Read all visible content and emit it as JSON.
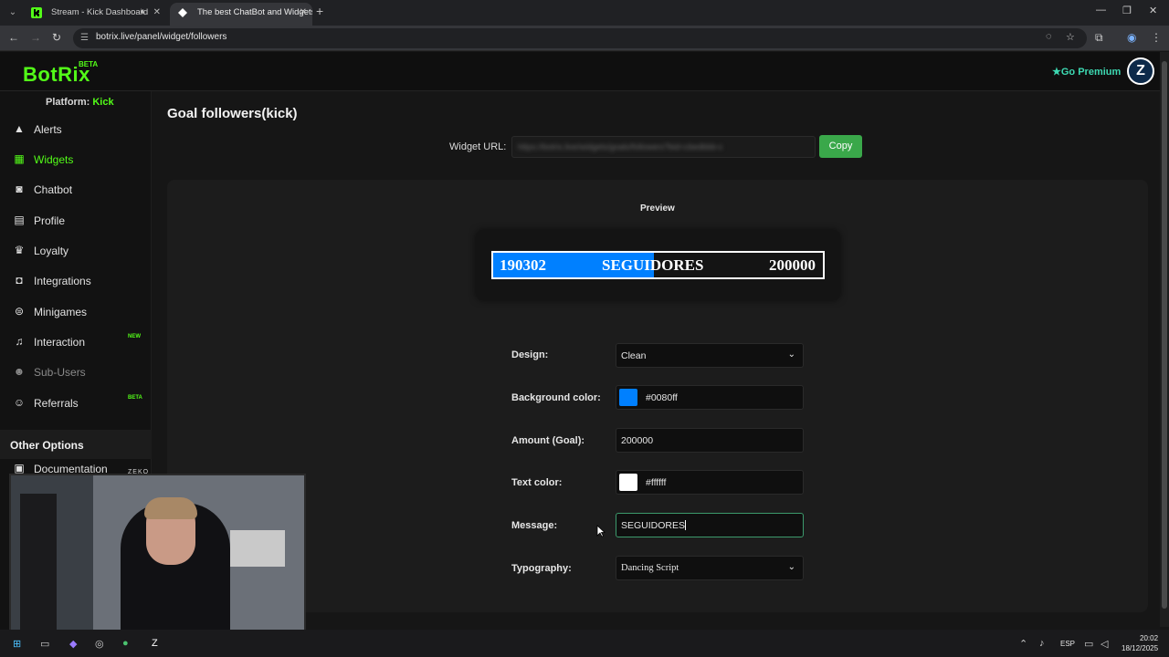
{
  "browser": {
    "tabs": [
      {
        "title": "Stream - Kick Dashboard",
        "active": false
      },
      {
        "title": "The best ChatBot and Widgets",
        "active": true
      }
    ],
    "url": "botrix.live/panel/widget/followers"
  },
  "header": {
    "logo": "BotRix",
    "logo_badge": "BETA",
    "premium_label": "Go Premium",
    "accent_color": "#53fc18"
  },
  "sidebar": {
    "platform_label": "Platform:",
    "platform_value": "Kick",
    "items": [
      {
        "label": "Alerts",
        "icon": "warning-icon"
      },
      {
        "label": "Widgets",
        "icon": "grid-icon",
        "active": true
      },
      {
        "label": "Chatbot",
        "icon": "robot-icon"
      },
      {
        "label": "Profile",
        "icon": "id-card-icon"
      },
      {
        "label": "Loyalty",
        "icon": "trophy-icon"
      },
      {
        "label": "Integrations",
        "icon": "puzzle-icon"
      },
      {
        "label": "Minigames",
        "icon": "gamepad-icon"
      },
      {
        "label": "Interaction",
        "icon": "music-icon",
        "badge": "NEW"
      },
      {
        "label": "Sub-Users",
        "icon": "users-icon",
        "disabled": true
      },
      {
        "label": "Referrals",
        "icon": "referral-icon",
        "badge": "BETA"
      }
    ],
    "other_options": "Other Options",
    "documentation": "Documentation"
  },
  "main": {
    "title": "Goal followers(kick)",
    "widget_url_label": "Widget URL:",
    "widget_url_value": "https://botrix.live/widgets/goals/followers?bid=cbedbbb-c",
    "copy_label": "Copy",
    "preview_label": "Preview",
    "goal": {
      "current": "190302",
      "message": "SEGUIDORES",
      "target": "200000",
      "progress": 0.4862,
      "fill_color": "#0080ff",
      "text_color": "#ffffff"
    },
    "form": {
      "design_label": "Design:",
      "design_value": "Clean",
      "bg_label": "Background color:",
      "bg_value": "#0080ff",
      "amount_label": "Amount (Goal):",
      "amount_value": "200000",
      "text_color_label": "Text color:",
      "text_color_value": "#ffffff",
      "message_label": "Message:",
      "message_value": "SEGUIDORES",
      "typography_label": "Typography:",
      "typography_value": "Dancing Script"
    }
  },
  "webcam": {
    "name_tag": "ZEKO"
  },
  "taskbar": {
    "language": "ESP",
    "time": "20:02",
    "date": "18/12/2025"
  }
}
